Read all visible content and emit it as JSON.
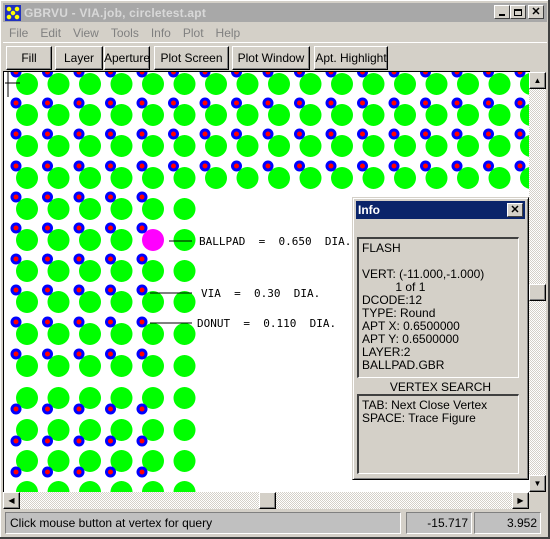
{
  "window": {
    "title": "GBRVU - VIA.job, circletest.apt",
    "icon": "gerber-app-icon",
    "controls": {
      "minimize": "_",
      "maximize": "□",
      "close": "✕"
    }
  },
  "menu": [
    "File",
    "Edit",
    "View",
    "Tools",
    "Info",
    "Plot",
    "Help"
  ],
  "toolbar": {
    "buttons": [
      "Fill",
      "Layer",
      "Aperture",
      "Plot Screen",
      "Plot Window",
      "Apt. Highlight"
    ]
  },
  "canvas": {
    "colors": {
      "background": "#ffffff",
      "pad": "#00ff00",
      "via": "#0000ff",
      "drill": "#ff0000",
      "highlight": "#ff00ff",
      "annotation": "#000000"
    },
    "annotations": [
      {
        "label": "BALLPAD  =  0.650  DIA."
      },
      {
        "label": "VIA  =  0.30  DIA."
      },
      {
        "label": "DONUT  =  0.110  DIA."
      }
    ]
  },
  "info_panel": {
    "title": "Info",
    "close": "✕",
    "lines": [
      "FLASH",
      "",
      "VERT: (-11.000,-1.000)",
      "          1 of 1",
      "DCODE:12",
      "TYPE: Round",
      "APT X: 0.6500000",
      "APT Y: 0.6500000",
      "LAYER:2",
      "BALLPAD.GBR"
    ],
    "vertex_search_label": "VERTEX SEARCH",
    "vertex_search_lines": [
      "TAB: Next Close Vertex",
      "SPACE: Trace Figure"
    ]
  },
  "scrollbars": {
    "up": "▲",
    "down": "▼",
    "left": "◀",
    "right": "▶"
  },
  "status": {
    "message": "Click mouse button at vertex for query",
    "x": "-15.717",
    "y": "3.952"
  }
}
